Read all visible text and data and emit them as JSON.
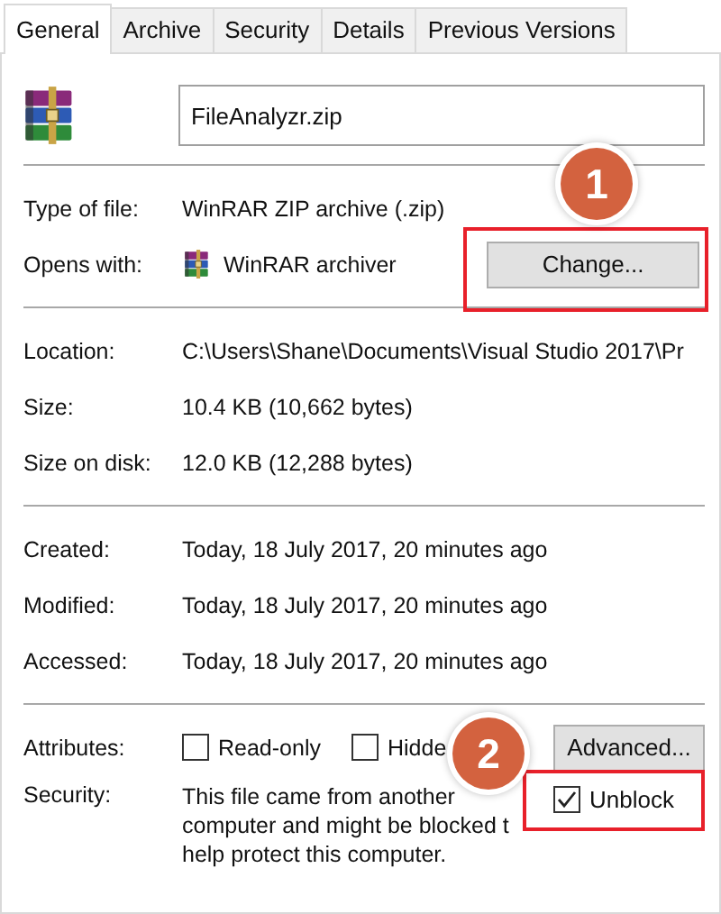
{
  "tabs": [
    {
      "label": "General",
      "selected": true
    },
    {
      "label": "Archive",
      "selected": false
    },
    {
      "label": "Security",
      "selected": false
    },
    {
      "label": "Details",
      "selected": false
    },
    {
      "label": "Previous Versions",
      "selected": false
    }
  ],
  "file_name": "FileAnalyzr.zip",
  "type_of_file": {
    "label": "Type of file:",
    "value": "WinRAR ZIP archive (.zip)"
  },
  "opens_with": {
    "label": "Opens with:",
    "value": "WinRAR archiver",
    "button": "Change..."
  },
  "location_info": [
    {
      "label": "Location:",
      "value": "C:\\Users\\Shane\\Documents\\Visual Studio 2017\\Pr"
    },
    {
      "label": "Size:",
      "value": "10.4 KB (10,662 bytes)"
    },
    {
      "label": "Size on disk:",
      "value": "12.0 KB (12,288 bytes)"
    }
  ],
  "dates": [
    {
      "label": "Created:",
      "value": "Today, 18 July 2017, 20 minutes ago"
    },
    {
      "label": "Modified:",
      "value": "Today, 18 July 2017, 20 minutes ago"
    },
    {
      "label": "Accessed:",
      "value": "Today, 18 July 2017, 20 minutes ago"
    }
  ],
  "attributes": {
    "label": "Attributes:",
    "checkboxes": [
      {
        "label": "Read-only",
        "checked": false
      },
      {
        "label": "Hidde",
        "checked": false
      }
    ],
    "button": "Advanced..."
  },
  "security": {
    "label": "Security:",
    "lines": [
      "This file came from another",
      "computer and might be blocked t",
      "help protect this computer."
    ],
    "unblock": {
      "label": "Unblock",
      "checked": true
    }
  },
  "callouts": [
    {
      "number": "1"
    },
    {
      "number": "2"
    }
  ]
}
